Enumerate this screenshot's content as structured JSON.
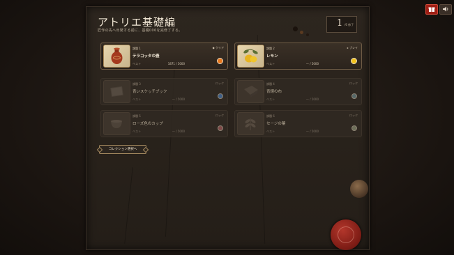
{
  "header": {
    "title": "アトリエ基礎編",
    "subtitle": "匠作の先へ出発する前に、基礎006を完修了する。",
    "counter_value": "1",
    "counter_label": "/6 修了"
  },
  "top_buttons": {
    "gift_icon": "gift-icon",
    "sound_icon": "speaker-icon",
    "accent": "#a11f15"
  },
  "courses": [
    {
      "course": "課題 1",
      "name": "テラコッタの壺",
      "best_label": "ベスト",
      "score": "1871 / 5000",
      "status": "◆ クリア",
      "dot_color": "#e8761b",
      "icon": "vase-icon"
    },
    {
      "course": "課題 2",
      "name": "レモン",
      "best_label": "ベスト",
      "score": "— / 5000",
      "status": "▸ プレイ",
      "dot_color": "#f2c21a",
      "icon": "lemon-icon"
    },
    {
      "course": "課題 3",
      "name": "青いスケッチブック",
      "best_label": "ベスト",
      "score": "— / 5000",
      "status": "ロック",
      "dot_color": "#3f5f86",
      "icon": "sketchbook-icon"
    },
    {
      "course": "課題 4",
      "name": "青銅の布",
      "best_label": "ベスト",
      "score": "— / 5000",
      "status": "ロック",
      "dot_color": "#566868",
      "icon": "cloth-icon"
    },
    {
      "course": "課題 5",
      "name": "ローズ色のカップ",
      "best_label": "ベスト",
      "score": "— / 5000",
      "status": "ロック",
      "dot_color": "#7e4a48",
      "icon": "cup-icon"
    },
    {
      "course": "課題 6",
      "name": "セージの葉",
      "best_label": "ベスト",
      "score": "— / 5000",
      "status": "ロック",
      "dot_color": "#6d6f59",
      "icon": "leaf-icon"
    }
  ],
  "buttons": {
    "collection_select": "コレクション選択へ"
  }
}
